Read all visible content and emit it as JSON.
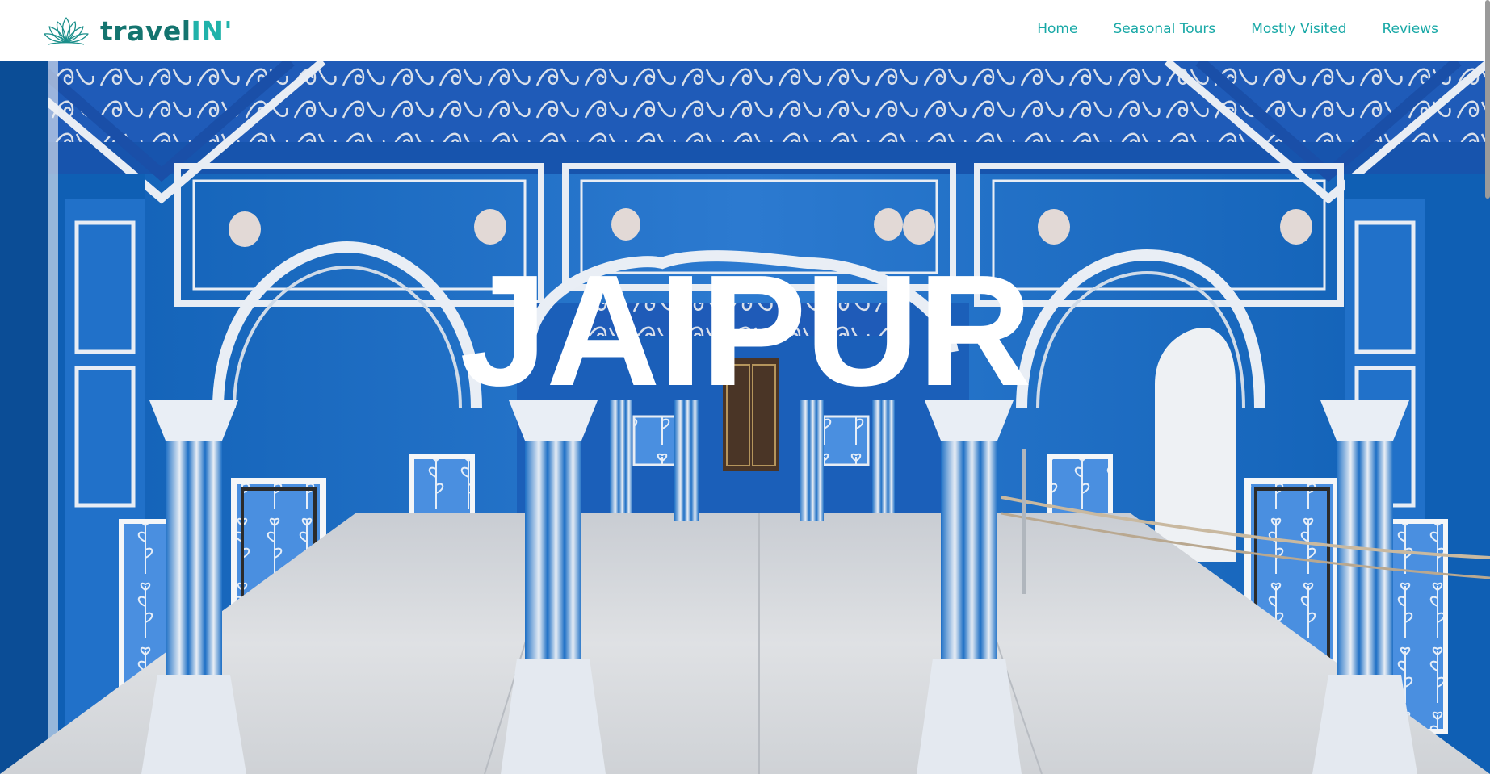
{
  "brand": {
    "name_part1": "travel",
    "name_part2": "IN'",
    "logo_icon": "lotus-icon"
  },
  "nav": {
    "items": [
      {
        "label": "Home"
      },
      {
        "label": "Seasonal Tours"
      },
      {
        "label": "Mostly Visited"
      },
      {
        "label": "Reviews"
      }
    ]
  },
  "hero": {
    "title": "JAIPUR"
  },
  "colors": {
    "brand_dark": "#14746f",
    "brand_light": "#20b2aa",
    "nav_link": "#17a8a6",
    "hero_blue": "#2f6fc4"
  }
}
